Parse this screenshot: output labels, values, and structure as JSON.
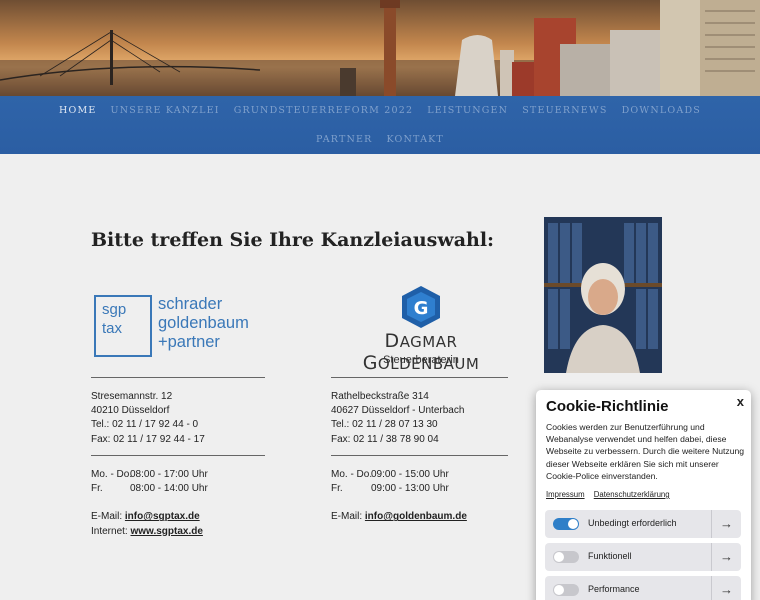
{
  "nav": {
    "items_row1": [
      {
        "label": "Home",
        "active": true
      },
      {
        "label": "Unsere Kanzlei",
        "active": false
      },
      {
        "label": "Grundsteuerreform 2022",
        "active": false
      },
      {
        "label": "Leistungen",
        "active": false
      },
      {
        "label": "Steuernews",
        "active": false
      },
      {
        "label": "Downloads",
        "active": false
      }
    ],
    "items_row2": [
      {
        "label": "Partner",
        "active": false
      },
      {
        "label": "Kontakt",
        "active": false
      }
    ]
  },
  "main": {
    "title": "Bitte treffen Sie Ihre Kanzleiauswahl:"
  },
  "office1": {
    "logo": {
      "box_top": "sgp",
      "box_bottom": "tax",
      "line1": "schrader",
      "line2": "goldenbaum",
      "line3": "+partner"
    },
    "street": "Stresemannstr. 12",
    "city": "40210 Düsseldorf",
    "tel_label": "Tel.:",
    "tel": "02 11 / 17 92 44 - 0",
    "fax_label": "Fax:",
    "fax": "02 11 / 17 92 44 - 17",
    "hours1_days": "Mo. - Do.",
    "hours1_time": "08:00 - 17:00 Uhr",
    "hours2_days": "Fr.",
    "hours2_time": "08:00 - 14:00 Uhr",
    "email_label": "E-Mail:",
    "email": "info@sgptax.de",
    "web_label": "Internet:",
    "web": "www.sgptax.de"
  },
  "office2": {
    "logo": {
      "letter": "G",
      "name_first_cap": "D",
      "name_first_rest": "AGMAR",
      "name_last_cap": "G",
      "name_last_rest": "OLDENBAUM",
      "sub": "Steuerberaterin"
    },
    "street": "Rathelbeckstraße 314",
    "city": "40627 Düsseldorf - Unterbach",
    "tel_label": "Tel.:",
    "tel": "02 11 / 28 07 13 30",
    "fax_label": "Fax:",
    "fax": "02 11 / 38 78 90 04",
    "hours1_days": "Mo. - Do.",
    "hours1_time": "09:00 - 15:00 Uhr",
    "hours2_days": "Fr.",
    "hours2_time": "09:00 - 13:00 Uhr",
    "email_label": "E-Mail:",
    "email": "info@goldenbaum.de"
  },
  "cookie": {
    "title": "Cookie-Richtlinie",
    "close": "x",
    "text": "Cookies werden zur Benutzerführung und Webanalyse verwendet und helfen dabei, diese Webseite zu verbessern. Durch die weitere Nutzung dieser Webseite erklären Sie sich mit unserer Cookie-Police einverstanden.",
    "link_impressum": "Impressum",
    "link_privacy": "Datenschutzerklärung",
    "options": [
      {
        "label": "Unbedingt erforderlich",
        "enabled": true
      },
      {
        "label": "Funktionell",
        "enabled": false
      },
      {
        "label": "Performance",
        "enabled": false
      }
    ],
    "arrow": "→"
  }
}
